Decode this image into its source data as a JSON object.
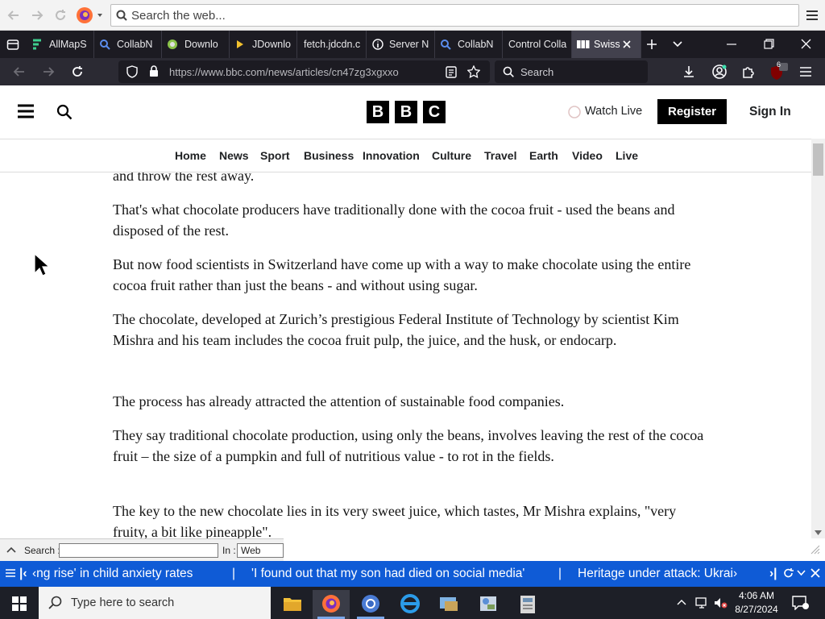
{
  "top_toolbar": {
    "search_placeholder": "Search the web..."
  },
  "tabs": [
    {
      "label": "AllMapS"
    },
    {
      "label": "CollabN"
    },
    {
      "label": "Downlo"
    },
    {
      "label": "JDownlo"
    },
    {
      "label": "fetch.jdcdn.c"
    },
    {
      "label": "Server N"
    },
    {
      "label": "CollabN"
    },
    {
      "label": "Control Colla"
    },
    {
      "label": "Swiss",
      "active": true
    }
  ],
  "nav_bar": {
    "url": "https://www.bbc.com/news/articles/cn47zg3xgxxo",
    "search_placeholder": "Search",
    "extension_badge": "6"
  },
  "bbc_header": {
    "logo": [
      "B",
      "B",
      "C"
    ],
    "watch_live": "Watch Live",
    "register": "Register",
    "sign_in": "Sign In"
  },
  "bbc_nav": [
    "Home",
    "News",
    "Sport",
    "Business",
    "Innovation",
    "Culture",
    "Travel",
    "Earth",
    "Video",
    "Live"
  ],
  "article": {
    "paragraphs": [
      "and throw the rest away.",
      "That's what chocolate producers have traditionally done with the cocoa fruit - used the beans and disposed of the rest.",
      "But now food scientists in Switzerland have come up with a way to make chocolate using the entire cocoa fruit rather than just the beans - and without using sugar.",
      "The chocolate, developed at Zurich’s prestigious Federal Institute of Technology by scientist Kim Mishra and his team includes the cocoa fruit pulp, the juice, and the husk, or endocarp.",
      "The process has already attracted the attention of sustainable food companies.",
      "They say traditional chocolate production, using only the beans, involves leaving the rest of the cocoa fruit – the size of a pumpkin and full of nutritious value - to rot in the fields.",
      "The key to the new chocolate lies in its very sweet juice, which tastes, Mr Mishra explains, \"very fruity, a bit like pineapple\"."
    ]
  },
  "find_bar": {
    "search_label": "Search :",
    "in_label": "In :",
    "in_value": "Web"
  },
  "ticker": {
    "items": [
      "‹ng rise' in child anxiety rates",
      "'I found out that my son had died on social media'",
      "Heritage under attack: Ukrai›"
    ],
    "nav_first": "|‹",
    "nav_last": "›|"
  },
  "taskbar": {
    "search_placeholder": "Type here to search",
    "time": "4:06 AM",
    "date": "8/27/2024"
  },
  "colors": {
    "ticker_bg": "#0f5bd6",
    "tab_strip_bg": "#1c1b22",
    "nav_bar_bg": "#2b2a33",
    "bbc_black": "#000000"
  }
}
